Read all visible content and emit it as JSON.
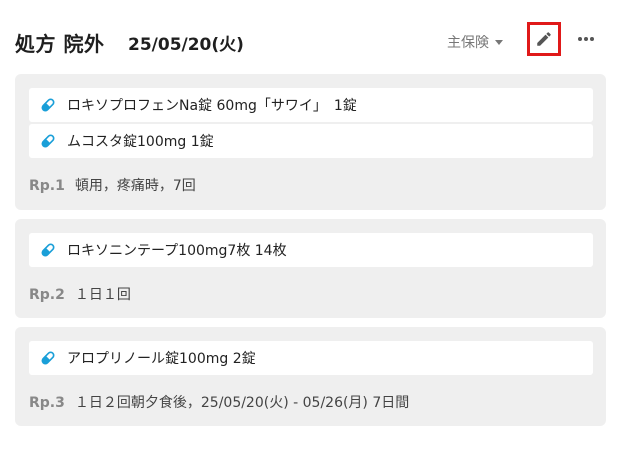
{
  "header": {
    "title": "処方 院外",
    "date": "25/05/20(火)",
    "insurance_label": "主保険"
  },
  "prescriptions": [
    {
      "items": [
        "ロキソプロフェンNa錠 60mg「サワイ」　1錠",
        "ムコスタ錠100mg  1錠"
      ],
      "rp_label": "Rp.1",
      "instructions": "頓用，疼痛時，7回"
    },
    {
      "items": [
        "ロキソニンテープ100mg7枚  14枚"
      ],
      "rp_label": "Rp.2",
      "instructions": "１日１回"
    },
    {
      "items": [
        "アロプリノール錠100mg  2錠"
      ],
      "rp_label": "Rp.3",
      "instructions": "１日２回朝夕食後，25/05/20(火) - 05/26(月) 7日間"
    }
  ],
  "colors": {
    "accent": "#1a9fd8",
    "highlight_border": "#e01919",
    "card_bg": "#efefef"
  },
  "icons": {
    "edit": "pencil-icon",
    "more": "ellipsis-icon",
    "item": "pill-icon",
    "dropdown": "chevron-down-icon"
  }
}
